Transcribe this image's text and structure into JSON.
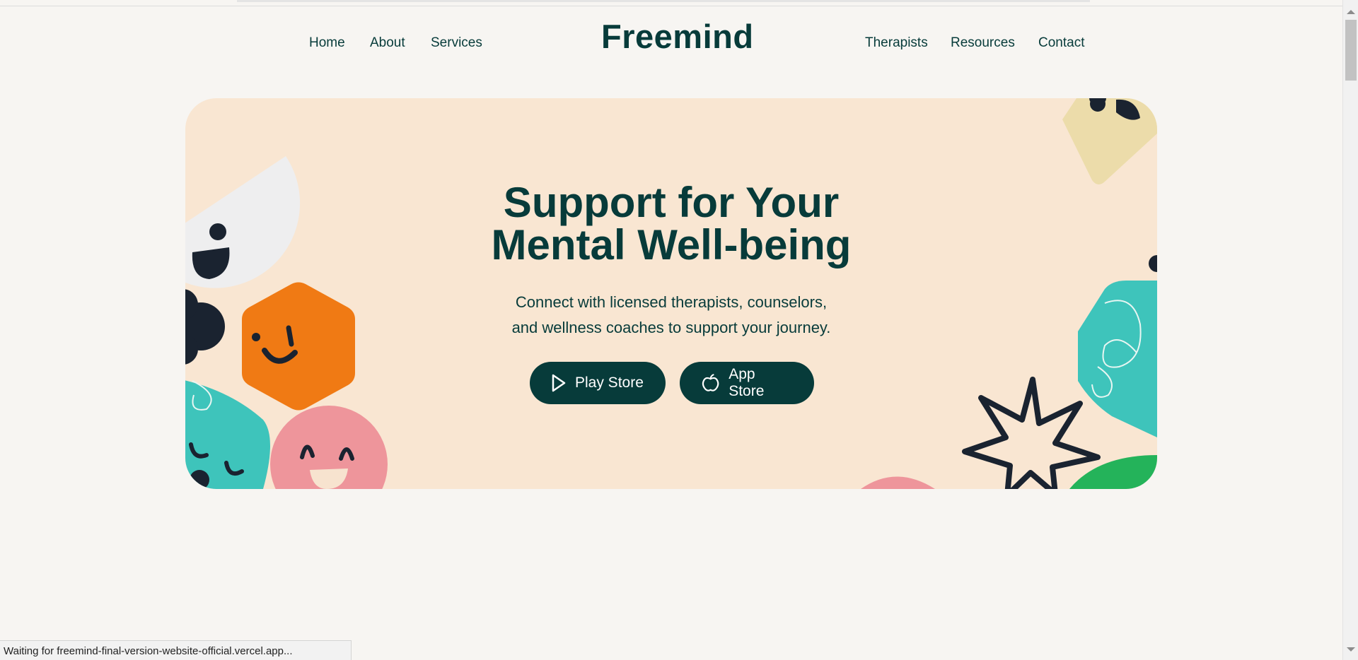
{
  "header": {
    "logo": "Freemind",
    "nav_left": [
      {
        "label": "Home"
      },
      {
        "label": "About"
      },
      {
        "label": "Services"
      }
    ],
    "nav_right": [
      {
        "label": "Therapists"
      },
      {
        "label": "Resources"
      },
      {
        "label": "Contact"
      }
    ]
  },
  "hero": {
    "headline_line1": "Support for Your",
    "headline_line2": "Mental Well-being",
    "subtitle_line1": "Connect with licensed therapists, counselors,",
    "subtitle_line2": "and wellness coaches to support your journey.",
    "buttons": [
      {
        "label": "Play Store",
        "icon": "play-triangle-icon"
      },
      {
        "label": "App Store",
        "icon": "apple-icon"
      }
    ]
  },
  "status": {
    "text": "Waiting for freemind-final-version-website-official.vercel.app..."
  },
  "colors": {
    "brand": "#073b3a",
    "page_bg": "#f7f5f2",
    "hero_bg": "#f9e6d2",
    "orange": "#f07a14",
    "teal": "#3ec4bb",
    "pink": "#ee959b",
    "green": "#24b35a",
    "sand": "#ecdcaa",
    "dark": "#1a2330"
  }
}
